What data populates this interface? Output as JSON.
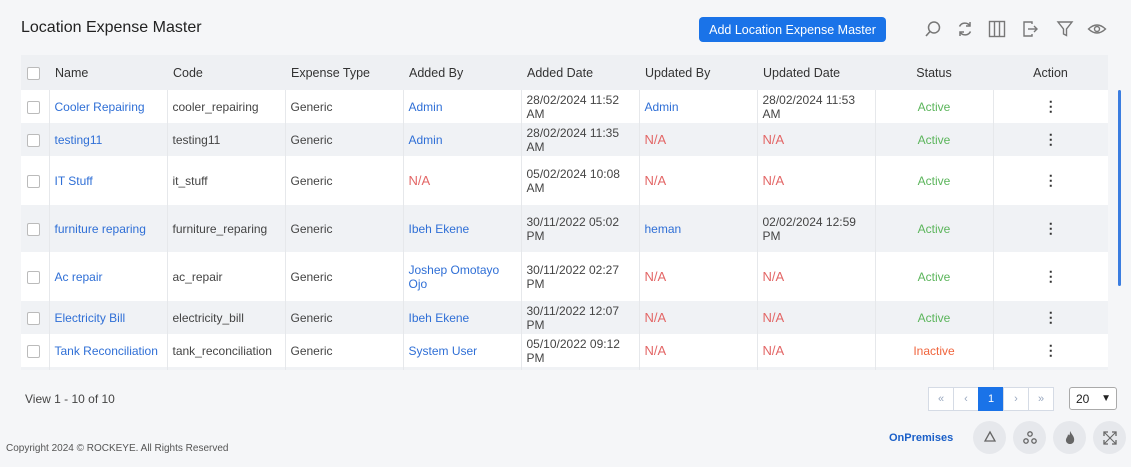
{
  "header": {
    "title": "Location Expense Master",
    "add_button": "Add Location Expense Master"
  },
  "toolbar_icons": [
    "search-icon",
    "refresh-icon",
    "columns-icon",
    "export-icon",
    "filter-icon",
    "eye-icon"
  ],
  "table": {
    "columns": [
      "Name",
      "Code",
      "Expense Type",
      "Added By",
      "Added Date",
      "Updated By",
      "Updated Date",
      "Status",
      "Action"
    ],
    "rows": [
      {
        "name": "Cooler Repairing",
        "code": "cooler_repairing",
        "type": "Generic",
        "added_by": "Admin",
        "added_date": "28/02/2024 11:52 AM",
        "updated_by": "Admin",
        "updated_date": "28/02/2024 11:53 AM",
        "status": "Active"
      },
      {
        "name": "testing11",
        "code": "testing11",
        "type": "Generic",
        "added_by": "Admin",
        "added_date": "28/02/2024 11:35 AM",
        "updated_by": "N/A",
        "updated_date": "N/A",
        "status": "Active"
      },
      {
        "name": "IT Stuff",
        "code": "it_stuff",
        "type": "Generic",
        "added_by": "N/A",
        "added_date": "05/02/2024 10:08 AM",
        "updated_by": "N/A",
        "updated_date": "N/A",
        "status": "Active"
      },
      {
        "name": "furniture reparing",
        "code": "furniture_reparing",
        "type": "Generic",
        "added_by": "Ibeh Ekene",
        "added_date": "30/11/2022 05:02 PM",
        "updated_by": "heman",
        "updated_date": "02/02/2024 12:59 PM",
        "status": "Active"
      },
      {
        "name": "Ac repair",
        "code": "ac_repair",
        "type": "Generic",
        "added_by": "Joshep Omotayo Ojo",
        "added_date": "30/11/2022 02:27 PM",
        "updated_by": "N/A",
        "updated_date": "N/A",
        "status": "Active"
      },
      {
        "name": "Electricity Bill",
        "code": "electricity_bill",
        "type": "Generic",
        "added_by": "Ibeh Ekene",
        "added_date": "30/11/2022 12:07 PM",
        "updated_by": "N/A",
        "updated_date": "N/A",
        "status": "Active"
      },
      {
        "name": "Tank Reconciliation",
        "code": "tank_reconciliation",
        "type": "Generic",
        "added_by": "System User",
        "added_date": "05/10/2022 09:12 PM",
        "updated_by": "N/A",
        "updated_date": "N/A",
        "status": "Inactive"
      }
    ]
  },
  "pagination": {
    "view_text": "View 1 - 10 of 10",
    "first": "«",
    "prev": "‹",
    "current": "1",
    "next": "›",
    "last": "»",
    "page_size": "20"
  },
  "footer": {
    "copyright": "Copyright 2024 © ROCKEYE. All Rights Reserved",
    "mode": "OnPremises"
  }
}
